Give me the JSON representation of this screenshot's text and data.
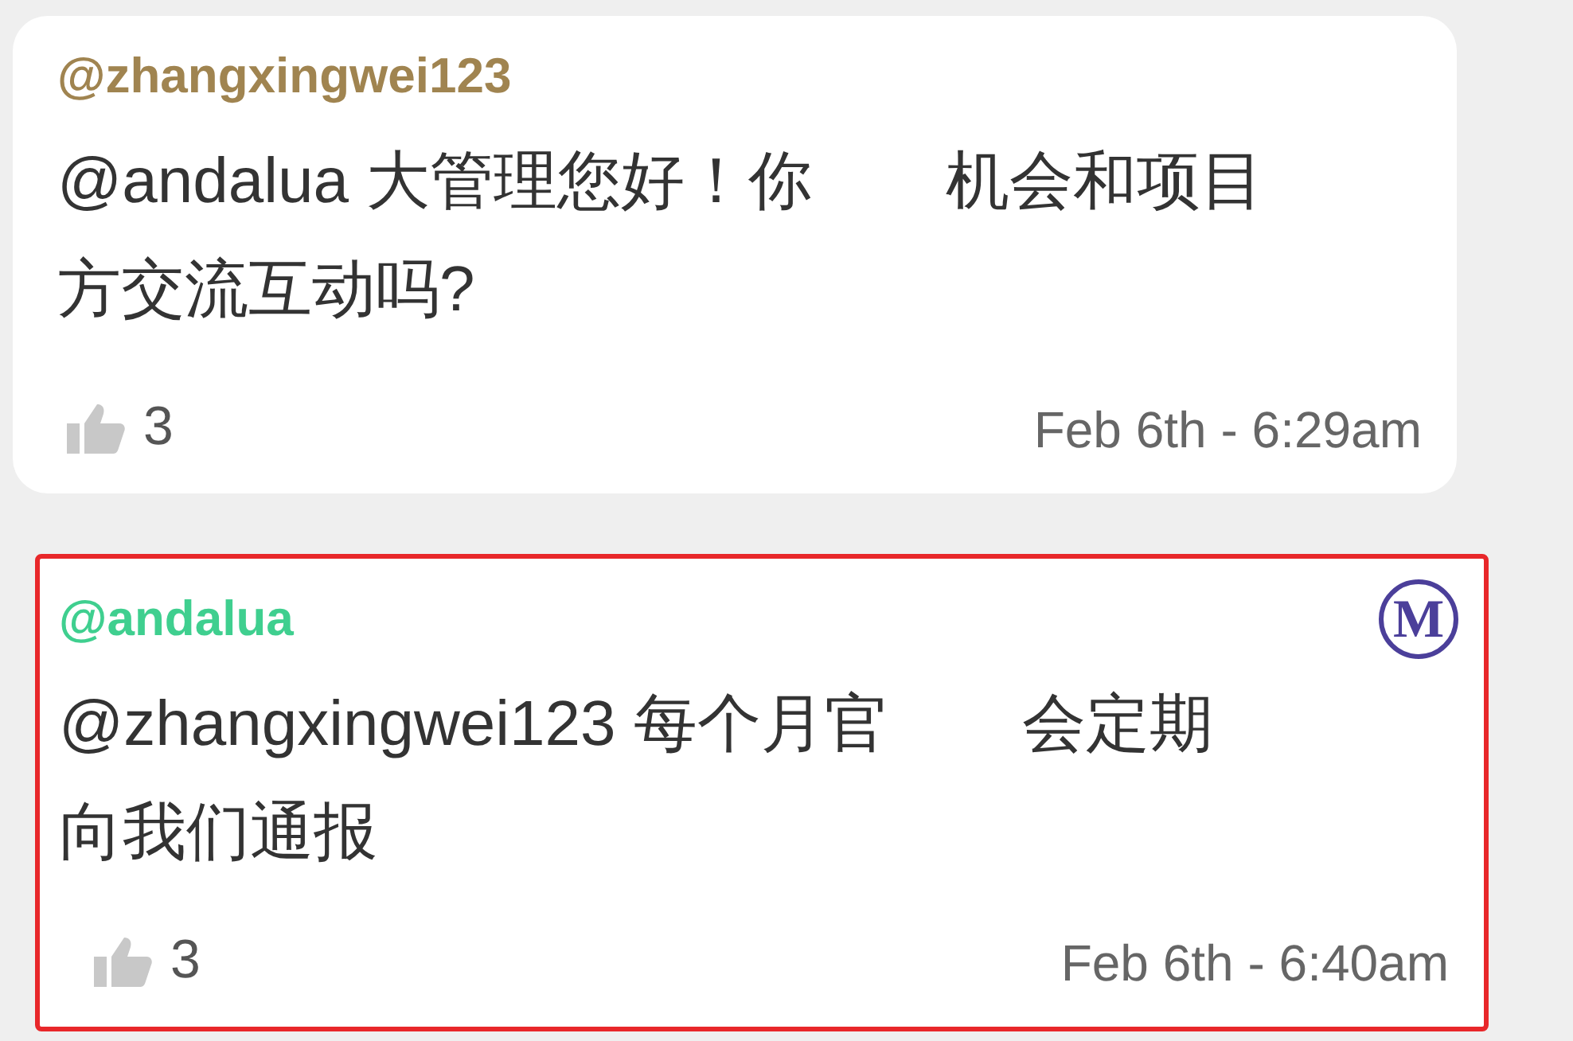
{
  "comments": [
    {
      "username": "@zhangxingwei123",
      "color": "#a08450",
      "highlighted": false,
      "lines": [
        [
          "@andalua 大管理您好！你",
          "机会和项目"
        ],
        [
          "方交流互动吗?"
        ]
      ],
      "likes": "3",
      "time": "Feb 6th - 6:29am"
    },
    {
      "username": "@andalua",
      "color": "#3fcf8f",
      "highlighted": true,
      "badge": "M",
      "lines": [
        [
          "@zhangxingwei123 每个月官",
          "会定期"
        ],
        [
          "向我们通报"
        ]
      ],
      "likes": "3",
      "time": "Feb 6th - 6:40am"
    }
  ]
}
